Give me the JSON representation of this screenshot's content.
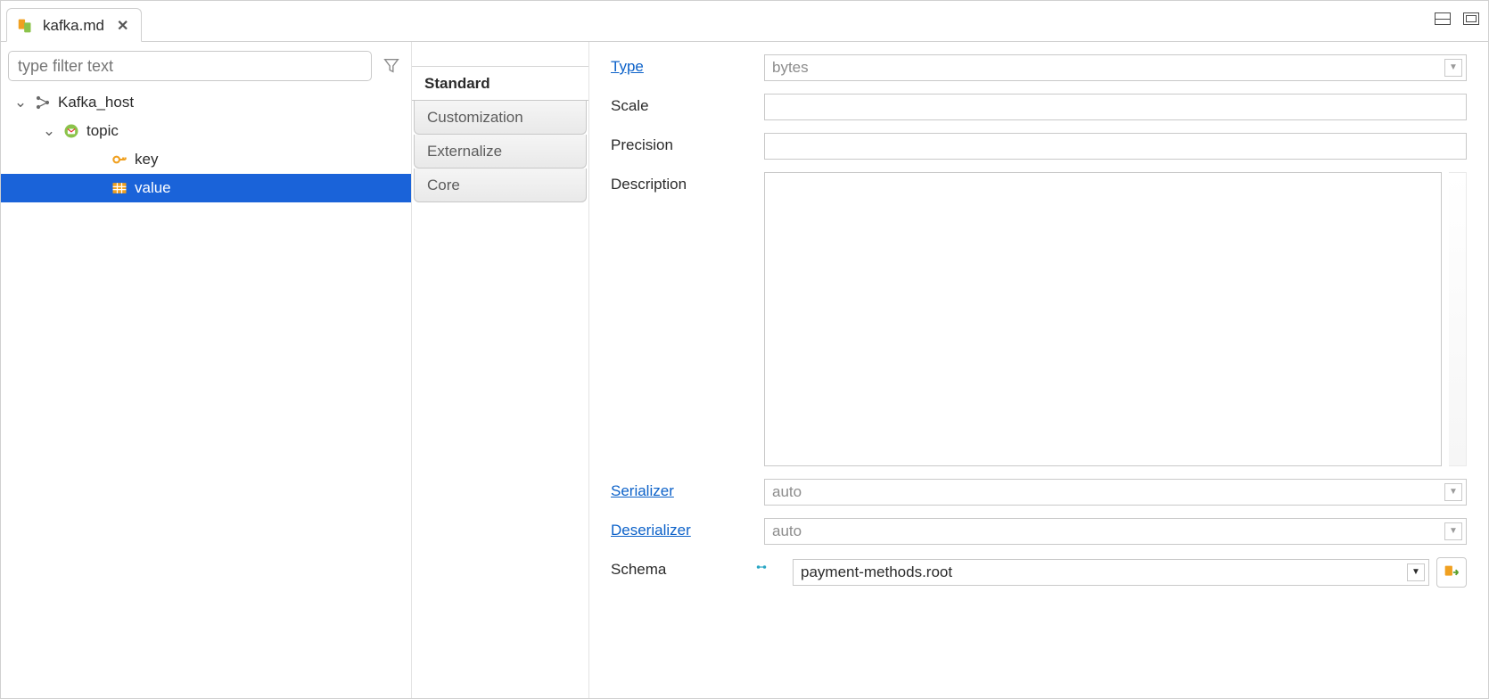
{
  "tab": {
    "label": "kafka.md",
    "icon": "file-icon"
  },
  "filter": {
    "placeholder": "type filter text"
  },
  "tree": [
    {
      "level": 0,
      "icon": "graph",
      "label": "Kafka_host",
      "expanded": true,
      "selected": false
    },
    {
      "level": 1,
      "icon": "topic",
      "label": "topic",
      "expanded": true,
      "selected": false
    },
    {
      "level": 2,
      "icon": "key",
      "label": "key",
      "expanded": false,
      "selected": false
    },
    {
      "level": 2,
      "icon": "table",
      "label": "value",
      "expanded": false,
      "selected": true
    }
  ],
  "categories": [
    {
      "label": "Standard",
      "active": true
    },
    {
      "label": "Customization",
      "active": false
    },
    {
      "label": "Externalize",
      "active": false
    },
    {
      "label": "Core",
      "active": false
    }
  ],
  "form": {
    "type_label": "Type",
    "type_value": "bytes",
    "scale_label": "Scale",
    "scale_value": "",
    "precision_label": "Precision",
    "precision_value": "",
    "description_label": "Description",
    "description_value": "",
    "serializer_label": "Serializer",
    "serializer_value": "auto",
    "deserializer_label": "Deserializer",
    "deserializer_value": "auto",
    "schema_label": "Schema",
    "schema_value": "payment-methods.root"
  }
}
